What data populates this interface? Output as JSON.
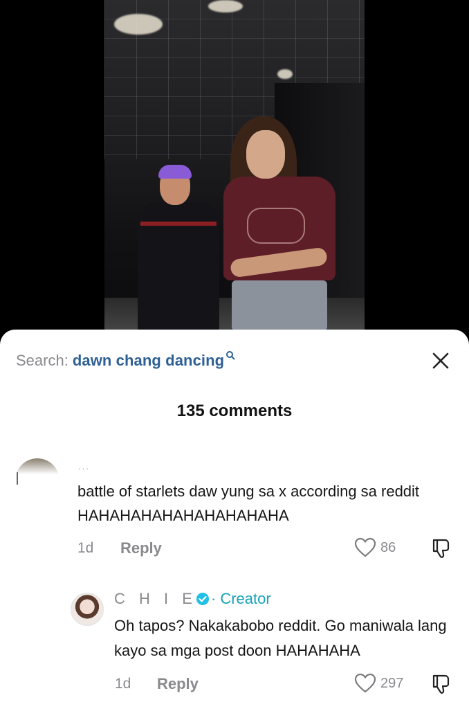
{
  "sheet": {
    "search_prefix": "Search:",
    "search_term": "dawn chang dancing",
    "search_icon": "search-icon",
    "close_icon": "close-icon",
    "comments_count": "135 comments"
  },
  "comments": [
    {
      "username_partial": "...",
      "text": "battle of starlets daw yung sa x according sa reddit HAHAHAHAHAHAHAHAHAHA",
      "time": "1d",
      "reply_label": "Reply",
      "likes": "86",
      "like_icon": "heart-icon",
      "dislike_icon": "dislike-icon"
    },
    {
      "author": "C H I E",
      "badge": "verified-icon",
      "role": "· Creator",
      "text": "Oh tapos? Nakakabobo reddit. Go maniwala lang kayo sa mga post doon HAHAHAHA",
      "time": "1d",
      "reply_label": "Reply",
      "likes": "297",
      "like_icon": "heart-icon",
      "dislike_icon": "dislike-icon"
    }
  ],
  "colors": {
    "link_blue": "#2d5f95",
    "creator_teal": "#17a3b8",
    "muted_gray": "#8a8a8e"
  }
}
